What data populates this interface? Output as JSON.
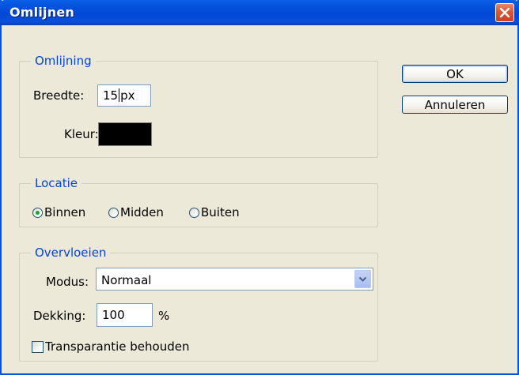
{
  "window": {
    "title": "Omlijnen"
  },
  "omlijning": {
    "legend": "Omlijning",
    "width_label": "Breedte:",
    "width_value": "15",
    "width_unit": "px",
    "color_label": "Kleur:",
    "color_value": "#000000"
  },
  "locatie": {
    "legend": "Locatie",
    "options": [
      {
        "label": "Binnen",
        "selected": true
      },
      {
        "label": "Midden",
        "selected": false
      },
      {
        "label": "Buiten",
        "selected": false
      }
    ]
  },
  "overvloeien": {
    "legend": "Overvloeien",
    "mode_label": "Modus:",
    "mode_value": "Normaal",
    "opacity_label": "Dekking:",
    "opacity_value": "100",
    "opacity_unit": "%",
    "preserve_label": "Transparantie behouden",
    "preserve_checked": false
  },
  "buttons": {
    "ok": "OK",
    "cancel": "Annuleren"
  },
  "icons": {
    "close": "close-icon",
    "dropdown": "chevron-down-icon"
  },
  "colors": {
    "accent": "#0046d5",
    "titlebar": "#0047d5",
    "close": "#d9573a",
    "radio_selected": "#21a121"
  }
}
